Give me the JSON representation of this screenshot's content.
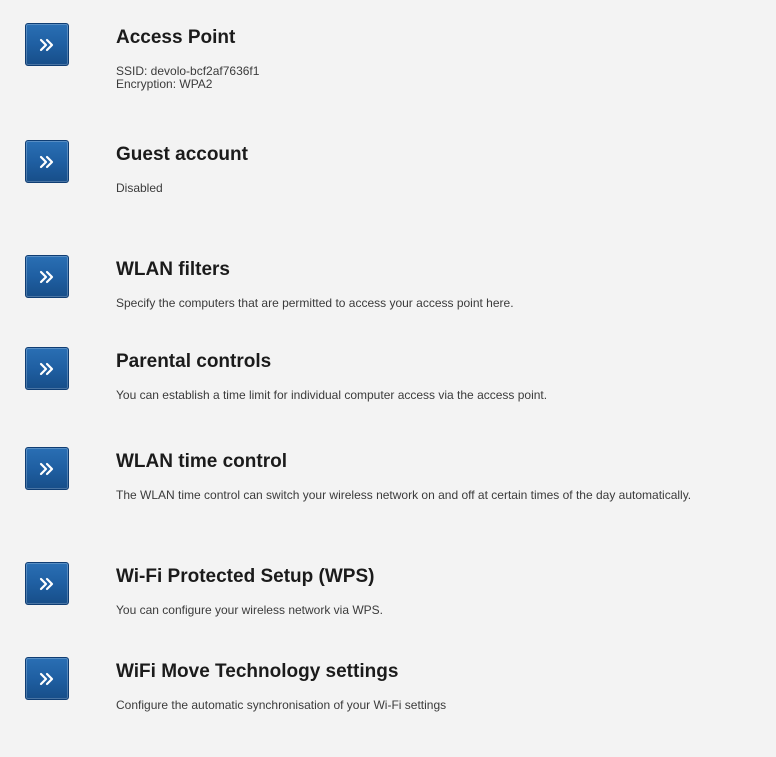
{
  "items": [
    {
      "title": "Access Point",
      "lines": [
        "SSID: devolo-bcf2af7636f1",
        "Encryption: WPA2"
      ]
    },
    {
      "title": "Guest account",
      "lines": [
        "Disabled"
      ]
    },
    {
      "title": "WLAN filters",
      "lines": [
        "Specify the computers that are permitted to access your access point here."
      ]
    },
    {
      "title": "Parental controls",
      "lines": [
        "You can establish a time limit for individual computer access via the access point."
      ]
    },
    {
      "title": "WLAN time control",
      "lines": [
        "The WLAN time control can switch your wireless network on and off at certain times of the day automatically."
      ]
    },
    {
      "title": "Wi-Fi Protected Setup (WPS)",
      "lines": [
        "You can configure your wireless network via WPS."
      ]
    },
    {
      "title": "WiFi Move Technology settings",
      "lines": [
        "Configure the automatic synchronisation of your Wi-Fi settings"
      ]
    }
  ],
  "colors": {
    "button": "#1f5fa2",
    "button_border": "#0f3d73",
    "background": "#f3f3f3"
  },
  "icons": {
    "button_icon": "double-chevron-right-icon"
  }
}
